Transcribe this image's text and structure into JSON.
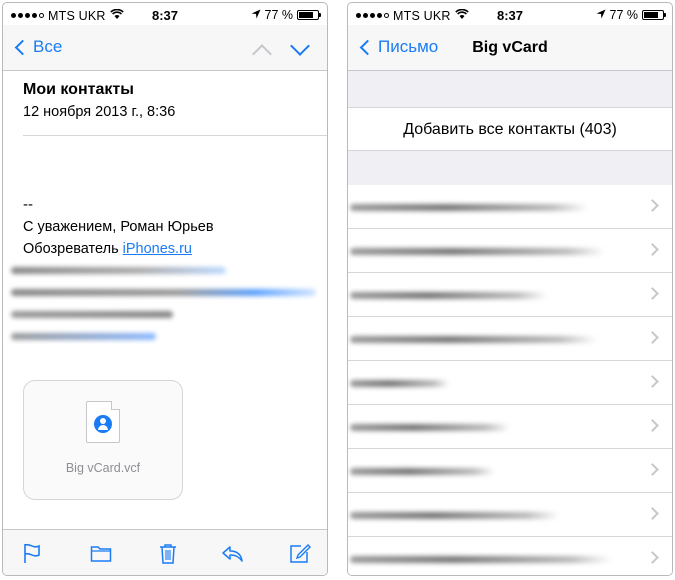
{
  "status": {
    "carrier": "MTS UKR",
    "time": "8:37",
    "battery": "77 %",
    "battery_level": 0.77
  },
  "mail": {
    "back_label": "Все",
    "subject": "Мои контакты",
    "date": "12 ноября 2013 г., 8:36",
    "dashes": "--",
    "signature_line1": "С уважением, Роман Юрьев",
    "signature_prefix": "Обозреватель ",
    "signature_link": "iPhones.ru",
    "attachment_name": "Big vCard.vcf",
    "toolbar_icons": [
      "flag-icon",
      "folder-icon",
      "trash-icon",
      "reply-icon",
      "compose-icon"
    ]
  },
  "vcard": {
    "back_label": "Письмо",
    "title": "Big vCard",
    "add_all_label": "Добавить все контакты (403)",
    "row_blur_fractions": [
      0.82,
      0.88,
      0.68,
      0.85,
      0.34,
      0.55,
      0.5,
      0.72,
      0.9
    ]
  },
  "colors": {
    "accent": "#1a7cf5",
    "separator": "#d6d6da",
    "group_bg": "#efeff4"
  }
}
